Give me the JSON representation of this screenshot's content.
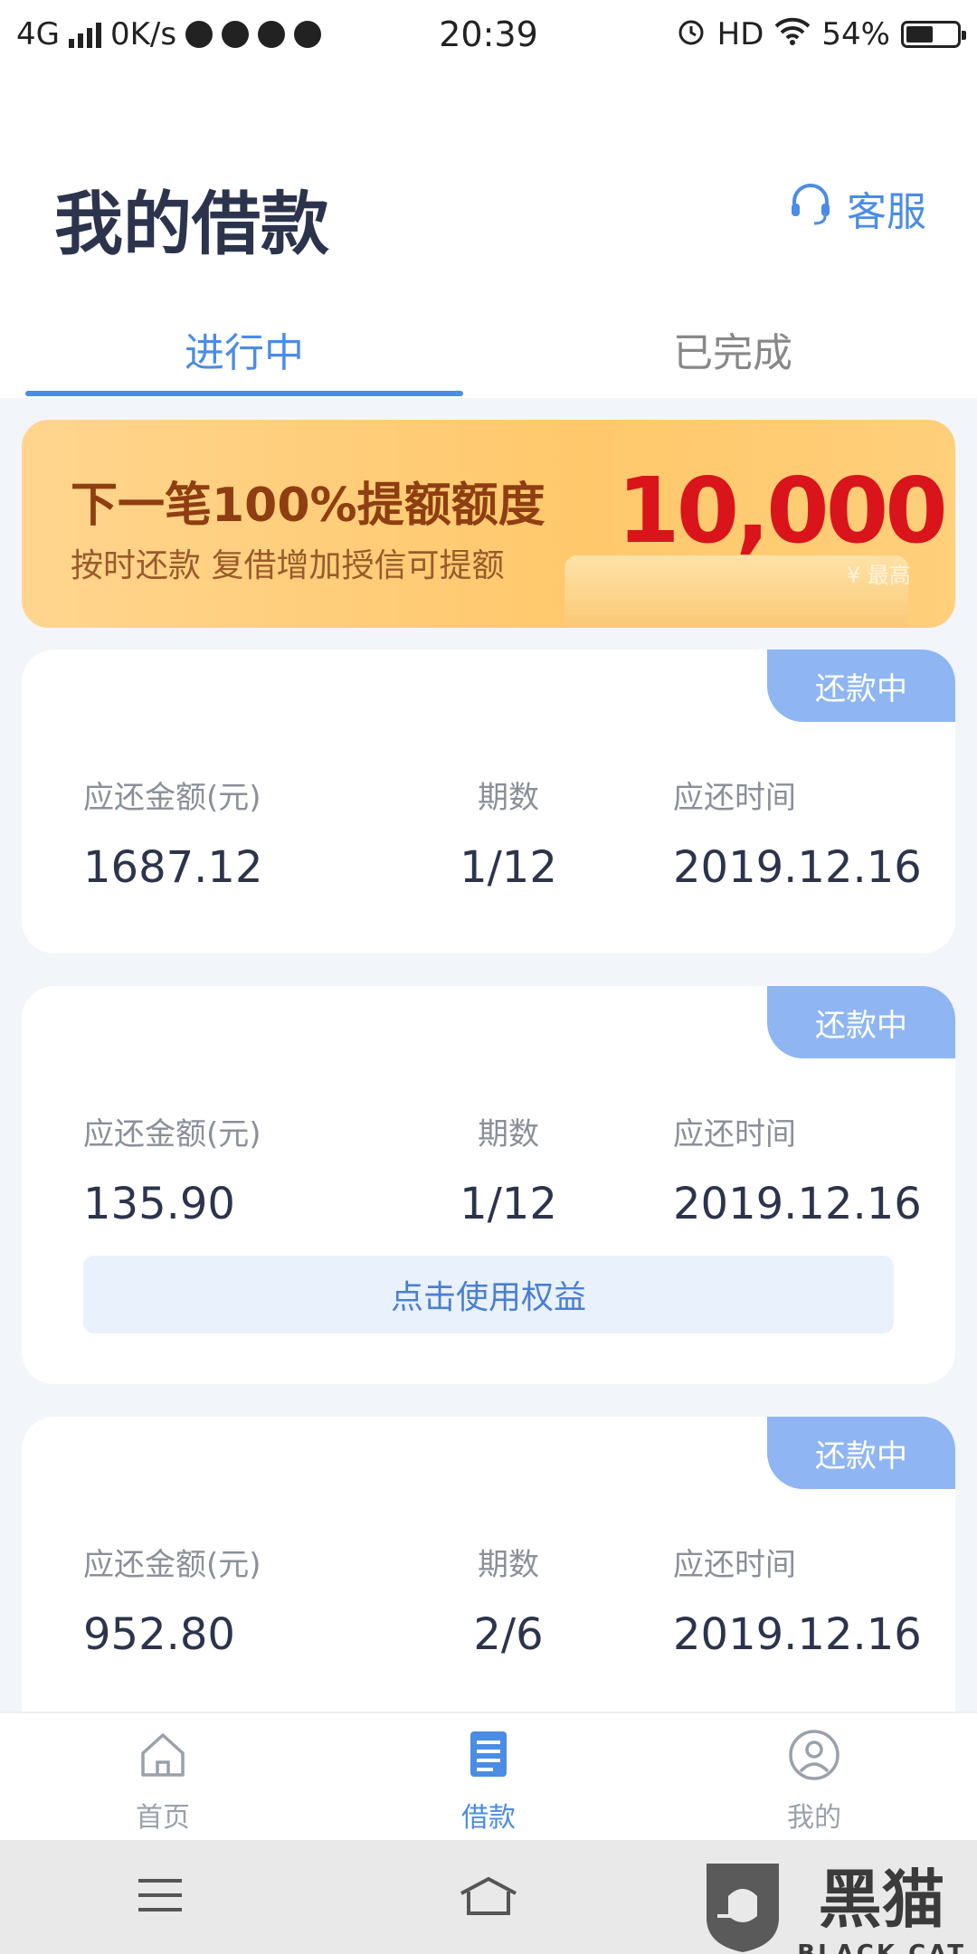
{
  "status_bar": {
    "network": "4G",
    "speed": "0K/s",
    "time": "20:39",
    "hd": "HD",
    "battery": "54%",
    "battery_level": 0.54
  },
  "header": {
    "title": "我的借款",
    "service_label": "客服"
  },
  "tabs": [
    {
      "label": "进行中",
      "active": true
    },
    {
      "label": "已完成",
      "active": false
    }
  ],
  "banner": {
    "title": "下一笔100%提额额度",
    "subtitle": "按时还款  复借增加授信可提额",
    "amount": "10,000",
    "note": "¥ 最高"
  },
  "cards": [
    {
      "badge": "还款中",
      "amount_label": "应还金额(元)",
      "amount": "1687.12",
      "period_label": "期数",
      "period": "1/12",
      "date_label": "应还时间",
      "date": "2019.12.16"
    },
    {
      "badge": "还款中",
      "amount_label": "应还金额(元)",
      "amount": "135.90",
      "period_label": "期数",
      "period": "1/12",
      "date_label": "应还时间",
      "date": "2019.12.16",
      "action": "点击使用权益"
    },
    {
      "badge": "还款中",
      "amount_label": "应还金额(元)",
      "amount": "952.80",
      "period_label": "期数",
      "period": "2/6",
      "date_label": "应还时间",
      "date": "2019.12.16"
    }
  ],
  "bottom_nav": [
    {
      "label": "首页",
      "icon": "home-icon",
      "active": false
    },
    {
      "label": "借款",
      "icon": "loan-document-icon",
      "active": true
    },
    {
      "label": "我的",
      "icon": "profile-icon",
      "active": false
    }
  ],
  "watermark": {
    "text": "黑猫",
    "subtext": "BLACK CAT"
  },
  "colors": {
    "accent": "#4a8ce6",
    "badge": "#8fb6f2",
    "banner_amount": "#d9141b"
  }
}
